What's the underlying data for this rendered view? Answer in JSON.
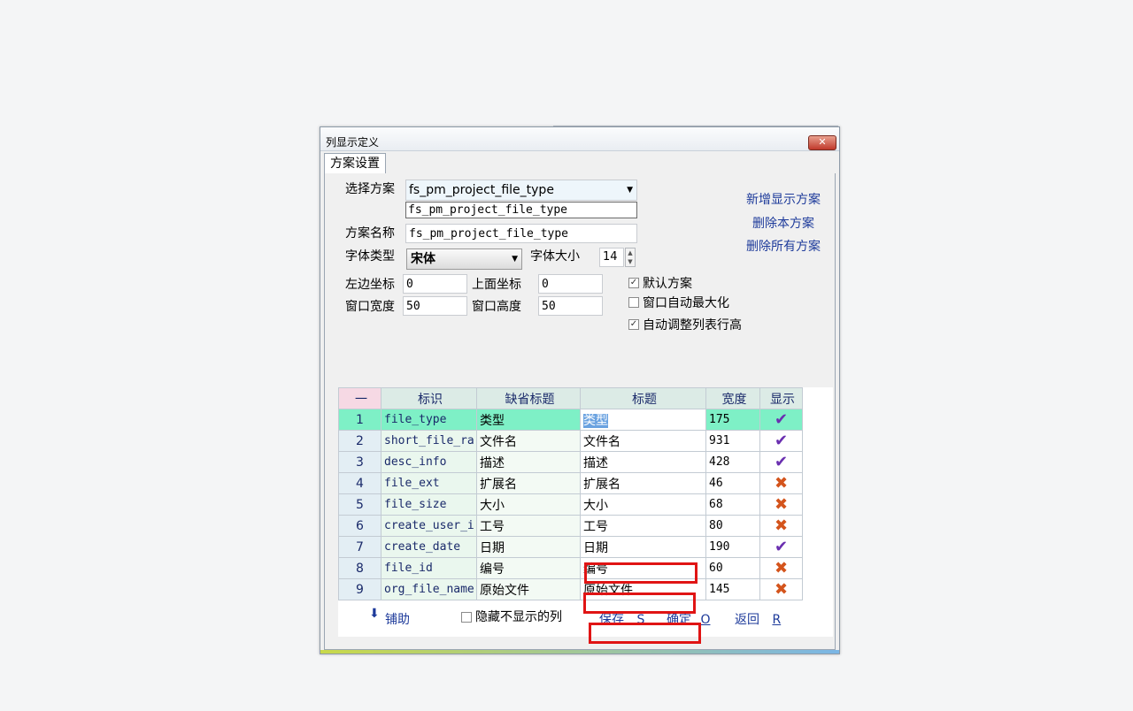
{
  "dialog": {
    "title": "列显示定义",
    "close_label": "✕",
    "tab": "方案设置"
  },
  "form": {
    "select_scheme_label": "选择方案",
    "select_scheme_value": "fs_pm_project_file_type",
    "dropdown_option": "fs_pm_project_file_type",
    "scheme_name_label": "方案名称",
    "scheme_name_value": "fs_pm_project_file_type",
    "font_type_label": "字体类型",
    "font_type_value": "宋体",
    "font_size_label": "字体大小",
    "font_size_value": "14",
    "left_label": "左边坐标",
    "left_value": "0",
    "top_label": "上面坐标",
    "top_value": "0",
    "width_label": "窗口宽度",
    "width_value": "50",
    "height_label": "窗口高度",
    "height_value": "50"
  },
  "links": {
    "add": "新增显示方案",
    "delete_this": "删除本方案",
    "delete_all": "删除所有方案"
  },
  "options": {
    "default_scheme": "默认方案",
    "auto_maximize": "窗口自动最大化",
    "auto_row_height": "自动调整列表行高"
  },
  "grid": {
    "headers": [
      "一",
      "标识",
      "缺省标题",
      "标题",
      "宽度",
      "显示"
    ],
    "rows": [
      {
        "n": "1",
        "id": "file_type",
        "default": "类型",
        "title": "类型",
        "width": "175",
        "show": "✔"
      },
      {
        "n": "2",
        "id": "short_file_ra",
        "default": "文件名",
        "title": "文件名",
        "width": "931",
        "show": "✔"
      },
      {
        "n": "3",
        "id": "desc_info",
        "default": "描述",
        "title": "描述",
        "width": "428",
        "show": "✔"
      },
      {
        "n": "4",
        "id": "file_ext",
        "default": "扩展名",
        "title": "扩展名",
        "width": "46",
        "show": "✖"
      },
      {
        "n": "5",
        "id": "file_size",
        "default": "大小",
        "title": "大小",
        "width": "68",
        "show": "✖"
      },
      {
        "n": "6",
        "id": "create_user_i",
        "default": "工号",
        "title": "工号",
        "width": "80",
        "show": "✖"
      },
      {
        "n": "7",
        "id": "create_date",
        "default": "日期",
        "title": "日期",
        "width": "190",
        "show": "✔"
      },
      {
        "n": "8",
        "id": "file_id",
        "default": "编号",
        "title": "编号",
        "width": "60",
        "show": "✖"
      },
      {
        "n": "9",
        "id": "org_file_name",
        "default": "原始文件",
        "title": "原始文件",
        "width": "145",
        "show": "✖"
      }
    ]
  },
  "footer": {
    "assist": "铺助",
    "hide_unshown": "隐藏不显示的列",
    "save": "保存",
    "save_key": "S",
    "ok": "确定",
    "ok_key": "O",
    "back": "返回",
    "back_key": "R"
  },
  "colors": {
    "selected_row": "#7ef0c6",
    "check": "#6a2fb0",
    "cross": "#d4541c",
    "annotation": "#e01414"
  }
}
